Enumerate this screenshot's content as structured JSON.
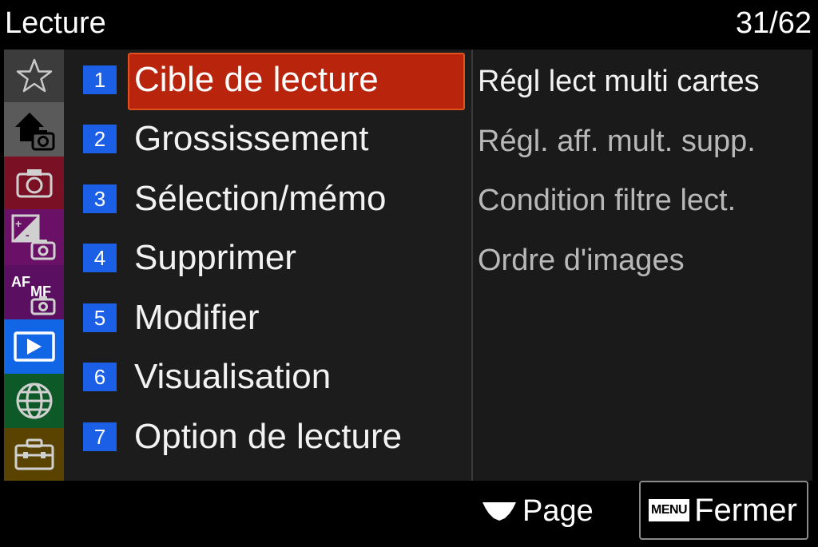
{
  "header": {
    "title": "Lecture",
    "counter": "31/62"
  },
  "categories": [
    {
      "icon": "star-icon",
      "bg": "#3c3c3c"
    },
    {
      "icon": "home-camera-icon",
      "bg": "#5a5a5a"
    },
    {
      "icon": "camera-icon",
      "bg": "#7a1024"
    },
    {
      "icon": "exposure-camera-icon",
      "bg": "#6a1066"
    },
    {
      "icon": "af-mf-camera-icon",
      "bg": "#5a0f60"
    },
    {
      "icon": "playback-icon",
      "bg": "#1166e6",
      "active": true
    },
    {
      "icon": "globe-icon",
      "bg": "#0d5a28"
    },
    {
      "icon": "toolbox-icon",
      "bg": "#5a4300"
    }
  ],
  "menu": {
    "items": [
      {
        "num": "1",
        "label": "Cible de lecture",
        "selected": true
      },
      {
        "num": "2",
        "label": "Grossissement"
      },
      {
        "num": "3",
        "label": "Sélection/mémo"
      },
      {
        "num": "4",
        "label": "Supprimer"
      },
      {
        "num": "5",
        "label": "Modifier"
      },
      {
        "num": "6",
        "label": "Visualisation"
      },
      {
        "num": "7",
        "label": "Option de lecture"
      }
    ]
  },
  "submenu": {
    "items": [
      "Régl lect multi cartes",
      "Régl. aff. mult. supp.",
      "Condition filtre lect.",
      "Ordre d'images"
    ]
  },
  "footer": {
    "page_label": "Page",
    "menu_key": "MENU",
    "close_label": "Fermer"
  },
  "colors": {
    "selection": "#b8240c",
    "number_badge": "#1a5fe6"
  }
}
